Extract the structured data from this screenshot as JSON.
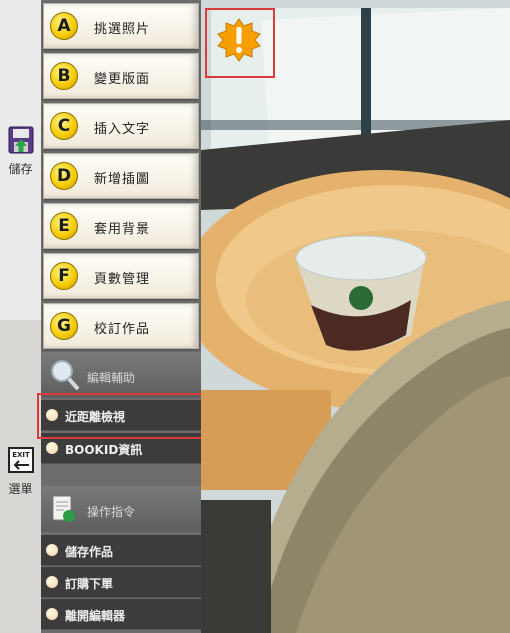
{
  "rail": {
    "save_label": "儲存",
    "menu_label": "選單",
    "exit_icon_text": "EXIT"
  },
  "menu": {
    "items": [
      {
        "letter": "A",
        "label": "挑選照片"
      },
      {
        "letter": "B",
        "label": "變更版面"
      },
      {
        "letter": "C",
        "label": "插入文字"
      },
      {
        "letter": "D",
        "label": "新增插圖"
      },
      {
        "letter": "E",
        "label": "套用背景"
      },
      {
        "letter": "F",
        "label": "頁數管理"
      },
      {
        "letter": "G",
        "label": "校訂作品"
      }
    ],
    "edit_section": {
      "title": "編輯輔助",
      "items": [
        "近距離檢視",
        "BOOKID資訊"
      ]
    },
    "command_section": {
      "title": "操作指令",
      "items": [
        "儲存作品",
        "訂購下單",
        "離開編輯器"
      ]
    }
  },
  "colors": {
    "menu_bg": "#6d6d6d",
    "letter_badge": "#f4c900",
    "highlight_border": "#d93b3b",
    "warning_badge": "#f5a000"
  }
}
